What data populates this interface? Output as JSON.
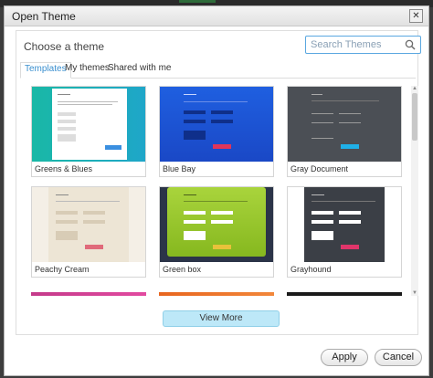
{
  "dialog": {
    "title": "Open Theme",
    "close_glyph": "✕"
  },
  "header": {
    "choose_label": "Choose a theme",
    "search_placeholder": "Search Themes",
    "search_value": ""
  },
  "tabs": [
    {
      "label": "Templates",
      "active": true
    },
    {
      "label": "My themes",
      "active": false
    },
    {
      "label": "Shared with me",
      "active": false
    }
  ],
  "themes": [
    {
      "name": "Greens & Blues"
    },
    {
      "name": "Blue Bay"
    },
    {
      "name": "Gray Document"
    },
    {
      "name": "Peachy Cream"
    },
    {
      "name": "Green box"
    },
    {
      "name": "Grayhound"
    }
  ],
  "buttons": {
    "view_more": "View More",
    "apply": "Apply",
    "cancel": "Cancel"
  },
  "colors": {
    "accent_tab": "#3a8fcf",
    "view_more_bg": "#bde8f8"
  }
}
